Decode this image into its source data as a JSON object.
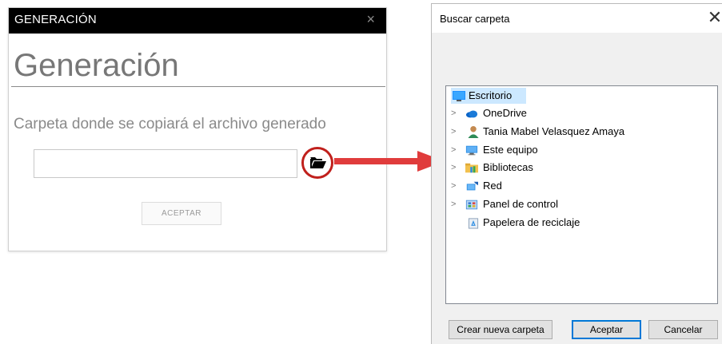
{
  "left_dialog": {
    "header_title": "GENERACIÓN",
    "close_glyph": "×",
    "big_title": "Generación",
    "folder_label": "Carpeta donde se copiará el archivo generado",
    "folder_input_value": "",
    "folder_button_icon": "open-folder-icon",
    "accept_label": "ACEPTAR"
  },
  "arrow": {
    "color": "#e03c3c"
  },
  "browse_window": {
    "title": "Buscar carpeta",
    "close_glyph": "✕",
    "tree": [
      {
        "label": "Escritorio",
        "icon": "desktop-icon",
        "expandable": false,
        "selected": true
      },
      {
        "label": "OneDrive",
        "icon": "onedrive-cloud-icon",
        "expandable": true
      },
      {
        "label": "Tania Mabel Velasquez Amaya",
        "icon": "user-icon",
        "expandable": true
      },
      {
        "label": "Este equipo",
        "icon": "computer-icon",
        "expandable": true
      },
      {
        "label": "Bibliotecas",
        "icon": "libraries-icon",
        "expandable": true
      },
      {
        "label": "Red",
        "icon": "network-icon",
        "expandable": true
      },
      {
        "label": "Panel de control",
        "icon": "control-panel-icon",
        "expandable": true
      },
      {
        "label": "Papelera de reciclaje",
        "icon": "recycle-bin-icon",
        "expandable": false
      }
    ],
    "buttons": {
      "new_folder": "Crear nueva carpeta",
      "accept": "Aceptar",
      "cancel": "Cancelar"
    }
  },
  "colors": {
    "header_bg": "#000000",
    "accent_red": "#c0201c",
    "selection": "#cce8ff",
    "primary_border": "#0078d7"
  }
}
